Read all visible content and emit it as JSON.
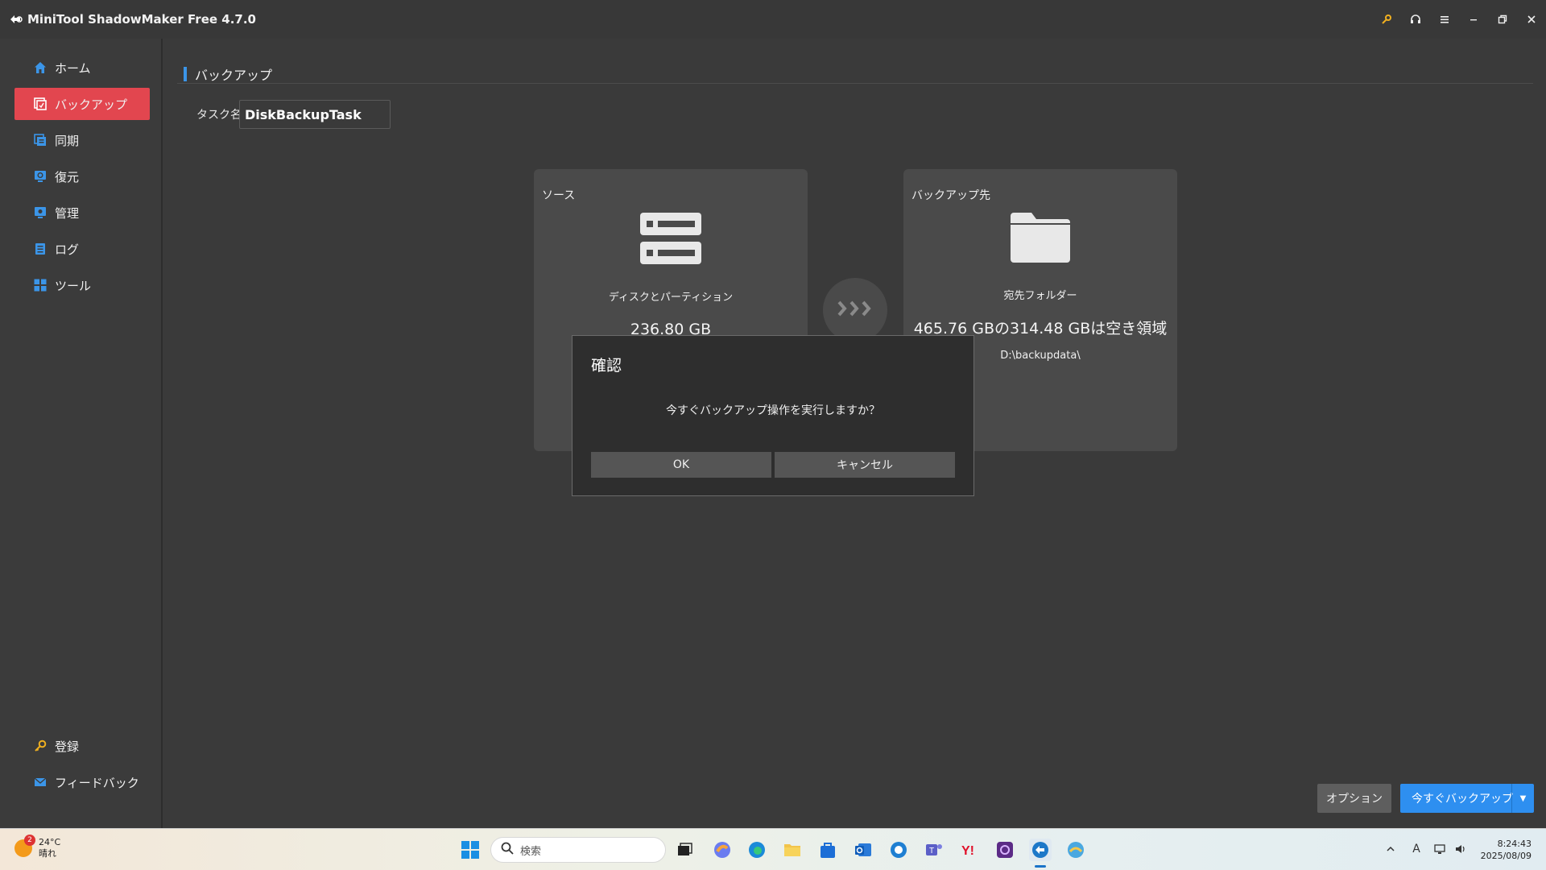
{
  "window": {
    "title": "MiniTool ShadowMaker Free 4.7.0",
    "controls": [
      "key-icon",
      "headset-icon",
      "menu-icon",
      "minimize-icon",
      "restore-icon",
      "close-icon"
    ]
  },
  "sidebar": {
    "items": [
      {
        "label": "ホーム",
        "icon": "home-icon"
      },
      {
        "label": "バックアップ",
        "icon": "backup-icon"
      },
      {
        "label": "同期",
        "icon": "sync-icon"
      },
      {
        "label": "復元",
        "icon": "restore-icon"
      },
      {
        "label": "管理",
        "icon": "manage-icon"
      },
      {
        "label": "ログ",
        "icon": "log-icon"
      },
      {
        "label": "ツール",
        "icon": "tools-icon"
      }
    ],
    "bottom": [
      {
        "label": "登録",
        "icon": "key-icon"
      },
      {
        "label": "フィードバック",
        "icon": "mail-icon"
      }
    ],
    "active_index": 1
  },
  "main": {
    "page_title": "バックアップ",
    "task_label": "タスク名:",
    "task_name": "DiskBackupTask",
    "source": {
      "title": "ソース",
      "subtitle": "ディスクとパーティション",
      "size": "236.80 GB"
    },
    "destination": {
      "title": "バックアップ先",
      "subtitle": "宛先フォルダー",
      "free_space": "465.76 GBの314.48 GBは空き領域",
      "path": "D:\\backupdata\\"
    },
    "options_label": "オプション",
    "backup_now_label": "今すぐバックアップ"
  },
  "dialog": {
    "title": "確認",
    "message": "今すぐバックアップ操作を実行しますか？",
    "ok_label": "OK",
    "cancel_label": "キャンセル"
  },
  "taskbar": {
    "weather_temp": "24°C",
    "weather_desc": "晴れ",
    "weather_badge": "2",
    "search_placeholder": "検索",
    "time": "8:24:43",
    "date": "2025/08/09",
    "ime": "A"
  },
  "colors": {
    "accent_active": "#e2464f",
    "primary_button": "#2e8ff0",
    "header_bar": "#3b95e8"
  }
}
